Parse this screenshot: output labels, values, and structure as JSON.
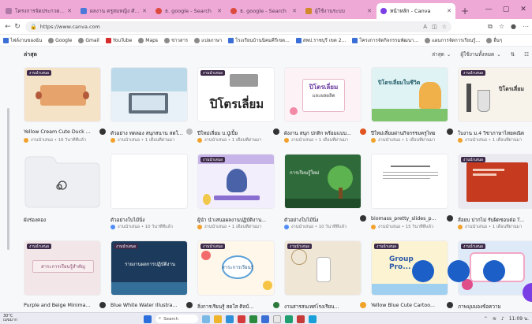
{
  "browser": {
    "tabs": [
      {
        "label": "โครงการจัดประกวดเรื่องสั้นฯ",
        "active": false
      },
      {
        "label": "ผลงาน ครูสมหญิง ศักดิ์จันทร์",
        "active": false
      },
      {
        "label": "ธ. google - Search",
        "active": false
      },
      {
        "label": "ธ. google - Search",
        "active": false
      },
      {
        "label": "ผู้ใช้งานระบบ",
        "active": false
      },
      {
        "label": "หน้าหลัก - Canva",
        "active": true
      }
    ],
    "new_tab": "+",
    "window_controls": {
      "minimize": "—",
      "maximize": "▢",
      "close": "✕"
    },
    "url": "https://www.canva.com",
    "bookmarks": [
      {
        "label": "ไฟล์งานของฉัน",
        "icon": "folder-icon"
      },
      {
        "label": "Google",
        "icon": "globe-icon"
      },
      {
        "label": "Gmail",
        "icon": "globe-icon"
      },
      {
        "label": "YouTube",
        "icon": "youtube-icon"
      },
      {
        "label": "Maps",
        "icon": "globe-icon"
      },
      {
        "label": "ข่าวสาร",
        "icon": "globe-icon"
      },
      {
        "label": "แปลภาษา",
        "icon": "globe-icon"
      },
      {
        "label": "โรงเรียนบ้านนิคมคีรีเขต...",
        "icon": "doc-icon"
      },
      {
        "label": "สพป.ราชบุรี เขต 2...",
        "icon": "doc-icon"
      },
      {
        "label": "โครงการจัดกิจกรรมพัฒนา...",
        "icon": "doc-icon"
      },
      {
        "label": "แผนการจัดการเรียนรู้...",
        "icon": "globe-icon"
      },
      {
        "label": "อื่นๆ",
        "icon": "globe-icon"
      }
    ]
  },
  "section": {
    "title": "ล่าสุด",
    "sort_label": "ล่าสุด",
    "owner_label": "ผู้ใช้งานทั้งหมด"
  },
  "designs": [
    {
      "name": "Yellow Cream Cute Duck ...",
      "meta": "งานนำเสนอ • 16 วินาทีที่แล้ว",
      "badge": "งานนำเสนอ",
      "art": "cream"
    },
    {
      "name": "ตัวอย่าง ทดลอง สนุกสนาน สดใส...",
      "meta": "งานนำเสนอ • 1 เดือนที่ผ่านมา",
      "badge": "",
      "art": "laptop"
    },
    {
      "name": "ปีใหม่เลี่ยม บ.ปู่เปิ้ย",
      "meta": "งานนำเสนอ • 1 เดือนที่ผ่านมา",
      "badge": "งานนำเสนอ",
      "art": "pitlem"
    },
    {
      "name": "ผังงาน สนุก ปกติก พร้อมแบบ...",
      "meta": "งานนำเสนอ • 1 เดือนที่ผ่านมา",
      "badge": "งานนำเสนอ",
      "art": "pinkslide"
    },
    {
      "name": "ปีใหม่เลี่ยมผ่านกิจกรรมครูไทย",
      "meta": "งานนำเสนอ • 1 เดือนที่ผ่านมา",
      "badge": "งานนำเสนอ",
      "art": "cartoon"
    },
    {
      "name": "ใบงาน ม.4 วิชาภาษาไทยคณิต",
      "meta": "งานนำเสนอ • 1 เดือนที่ผ่านมา",
      "badge": "งานนำเสนอ",
      "art": "lab"
    },
    {
      "name": "ผังร่องคอง",
      "meta": "",
      "badge": "",
      "art": "folder"
    },
    {
      "name": "ตัวอย่างใบไม้นิ่ง",
      "meta": "งานนำเสนอ • 10 วินาทีที่แล้ว",
      "badge": "",
      "art": "blank"
    },
    {
      "name": "ผู้นำ นำเสนอผลงานปฏิบัติงาน...",
      "meta": "งานนำเสนอ • 1 เดือนที่ผ่านมา",
      "badge": "งานนำเสนอ",
      "art": "profile"
    },
    {
      "name": "ตัวอย่างใบไม้นิ่ง",
      "meta": "งานนำเสนอ • 10 วินาทีที่แล้ว",
      "badge": "",
      "art": "greentree"
    },
    {
      "name": "biomass_pretty_slides_p...",
      "meta": "งานนำเสนอ • 15 วินาทีที่แล้ว",
      "badge": "",
      "art": "doc"
    },
    {
      "name": "ส้อยบ ปากไม่ รับผิดชอบต่อ T...",
      "meta": "งานนำเสนอ • 1 เดือนที่ผ่านมา",
      "badge": "งานนำเสนอ",
      "art": "red"
    },
    {
      "name": "Purple and Beige Minima...",
      "meta": "",
      "badge": "งานนำเสนอ",
      "art": "pinkbeige"
    },
    {
      "name": "Blue White Water Illustra...",
      "meta": "",
      "badge": "งานนำเสนอ",
      "art": "navy"
    },
    {
      "name": "สิ่งการเรียนรู้ สดใส ศิลป์...",
      "meta": "",
      "badge": "งานนำเสนอ",
      "art": "colorful"
    },
    {
      "name": "งานสารสนเทศโรงเรียน...",
      "meta": "",
      "badge": "งานนำเสนอ",
      "art": "beige"
    },
    {
      "name": "Yellow Blue Cute Cartoo...",
      "meta": "",
      "badge": "งานนำเสนอ",
      "art": "yellowcartoon"
    },
    {
      "name": "ภาพมุมมองข้อความ",
      "meta": "",
      "badge": "งานนำเสนอ",
      "art": "bluecartoon"
    }
  ],
  "thumb_text": {
    "pitlem": "ปิโตรเลี่ยม",
    "pinkslide_title": "ปิโตรเลี่ยม",
    "pinkslide_sub": "และผลผลิต",
    "cartoon_title": "ปิโตรเลี่ยมในชีวิต",
    "lab": "ปิโตรเลี่ยม",
    "green": "การเรียนรู้ใหม่",
    "navy": "รายงานผลการปฏิบัติงาน",
    "colorful": "สาระการเรียนรู้",
    "purple": "สาระการเรียนรู้สำคัญ",
    "yellowcartoon": "Group Pro..."
  },
  "taskbar": {
    "weather": "30°C เมฆมาก",
    "search": "Search",
    "clock": "11:09 น."
  }
}
